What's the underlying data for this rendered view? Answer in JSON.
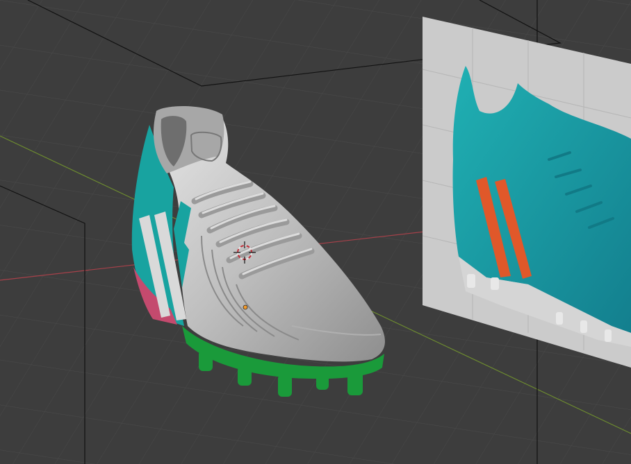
{
  "viewport": {
    "background_color": "#3d3d3d",
    "grid_color": "#4a4a4a",
    "x_axis_color": "#a8414a",
    "y_axis_color": "#6e8d2f",
    "object_outline_color": "#111111",
    "shoe_colors": {
      "body": "#c9c9c9",
      "accent": "#18a3a0",
      "sole": "#1a9a3a",
      "heel_accent": "#c44a6e"
    },
    "reference_image_colors": {
      "plane": "#c8c8c8",
      "boot": "#1a98a4",
      "stripes": "#e0582a"
    },
    "icons": {
      "cursor": "3d-cursor-icon",
      "origin": "object-origin-icon"
    }
  }
}
